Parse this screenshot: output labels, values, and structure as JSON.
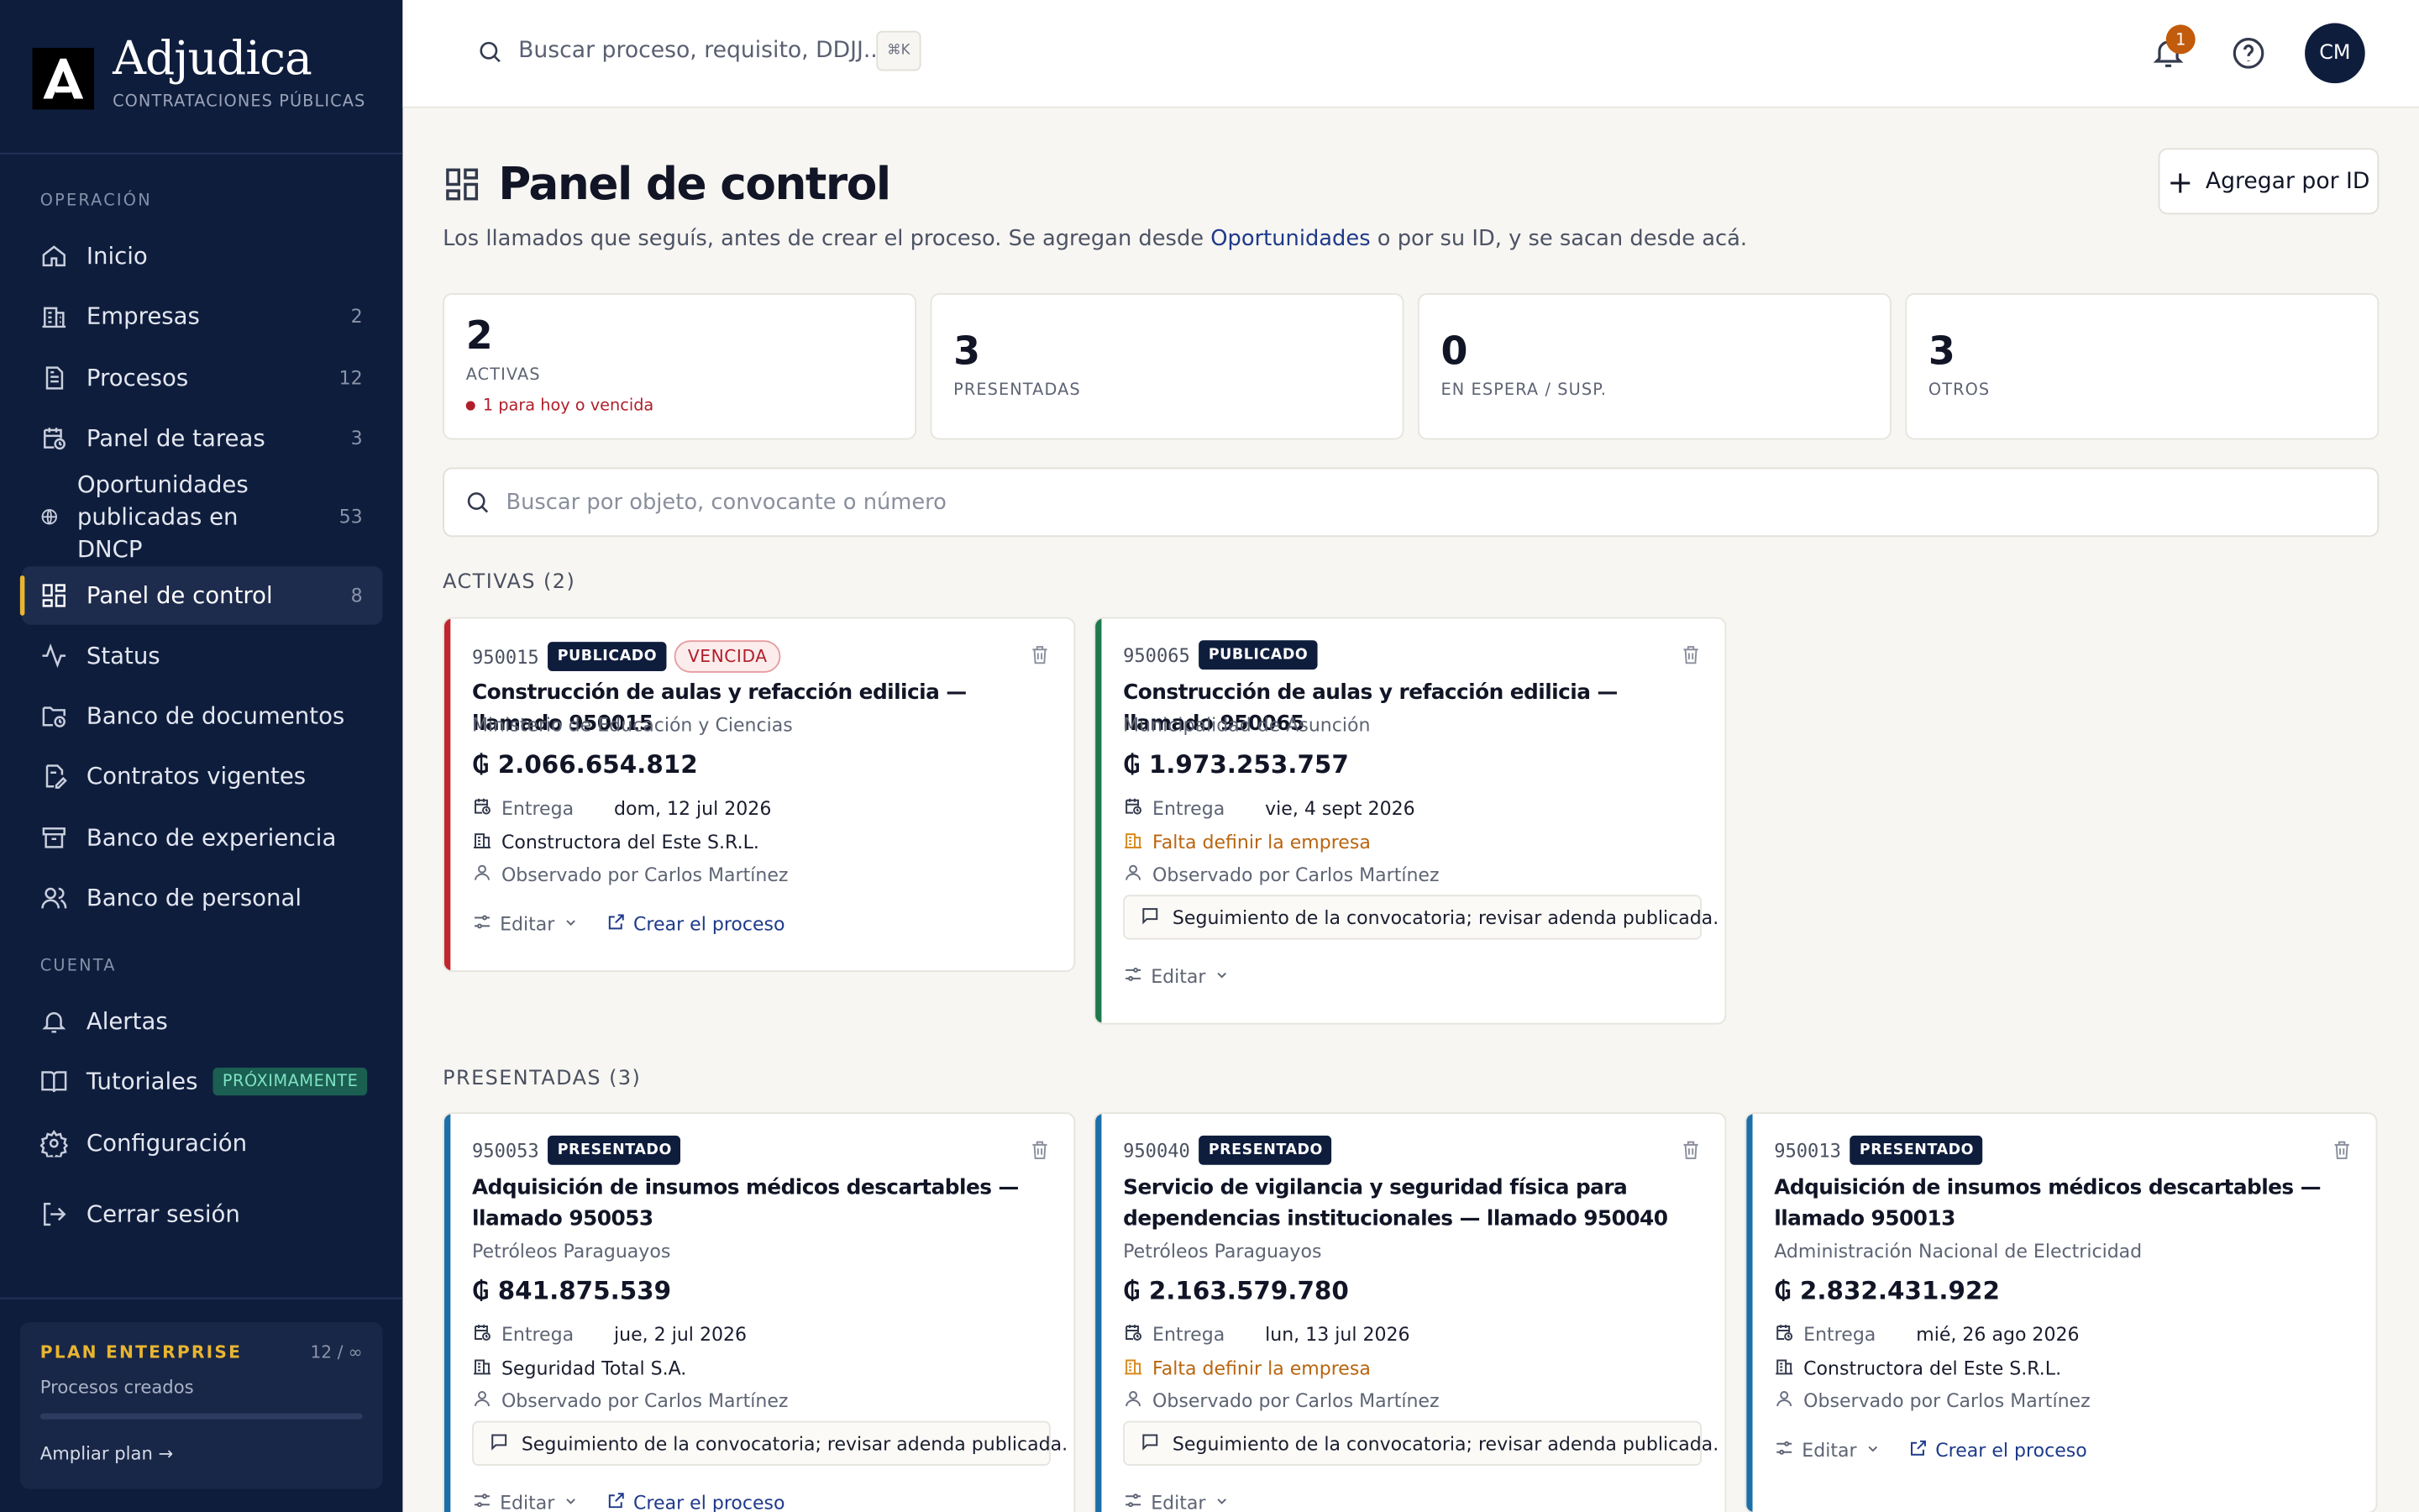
{
  "brand": {
    "name": "Adjudica",
    "subtitle": "CONTRATACIONES PÚBLICAS"
  },
  "sidebar": {
    "section_operacion": "OPERACIÓN",
    "section_cuenta": "CUENTA",
    "items": [
      {
        "label": "Inicio",
        "count": ""
      },
      {
        "label": "Empresas",
        "count": "2"
      },
      {
        "label": "Procesos",
        "count": "12"
      },
      {
        "label": "Panel de tareas",
        "count": "3"
      },
      {
        "label": "Oportunidades publicadas en DNCP",
        "count": "53"
      },
      {
        "label": "Panel de control",
        "count": "8"
      },
      {
        "label": "Status",
        "count": ""
      },
      {
        "label": "Banco de documentos",
        "count": ""
      },
      {
        "label": "Contratos vigentes",
        "count": ""
      },
      {
        "label": "Banco de experiencia",
        "count": ""
      },
      {
        "label": "Banco de personal",
        "count": ""
      }
    ],
    "account_items": [
      {
        "label": "Alertas"
      },
      {
        "label": "Tutoriales",
        "badge": "PRÓXIMAMENTE"
      },
      {
        "label": "Configuración"
      },
      {
        "label": "Cerrar sesión"
      }
    ],
    "plan": {
      "title": "PLAN ENTERPRISE",
      "count": "12 / ∞",
      "subtitle": "Procesos creados",
      "progress": 0.0,
      "link": "Ampliar plan →"
    }
  },
  "header": {
    "search_placeholder": "Buscar proceso, requisito, DDJJ...",
    "shortcut": "⌘K",
    "notifications": "1",
    "avatar": "CM"
  },
  "page": {
    "title": "Panel de control",
    "add_button": "Agregar por ID",
    "subtitle_pre": "Los llamados que seguís, antes de crear el proceso. Se agregan desde ",
    "subtitle_link": "Oportunidades",
    "subtitle_post": " o por su ID, y se sacan desde acá.",
    "search_placeholder": "Buscar por objeto, convocante o número"
  },
  "stats": [
    {
      "value": "2",
      "label": "ACTIVAS",
      "alert": "1 para hoy o vencida"
    },
    {
      "value": "3",
      "label": "PRESENTADAS"
    },
    {
      "value": "0",
      "label": "EN ESPERA / SUSP."
    },
    {
      "value": "3",
      "label": "OTROS"
    }
  ],
  "groups": {
    "activas": "ACTIVAS (2)",
    "presentadas": "PRESENTADAS (3)"
  },
  "labels": {
    "entrega": "Entrega",
    "editar": "Editar",
    "crear": "Crear el proceso"
  },
  "cards": [
    {
      "id": "950015",
      "status": "PUBLICADO",
      "flag": "VENCIDA",
      "title": "Construcción de aulas y refacción edilicia — llamado 950015",
      "org": "Ministerio de Educación y Ciencias",
      "amount": "₲ 2.066.654.812",
      "date": "dom, 12 jul 2026",
      "company": "Constructora del Este S.R.L.",
      "observer": "Observado por Carlos Martínez",
      "note": "",
      "accent": "#c0262d"
    },
    {
      "id": "950065",
      "status": "PUBLICADO",
      "flag": "",
      "title": "Construcción de aulas y refacción edilicia — llamado 950065",
      "org": "Municipalidad de Asunción",
      "amount": "₲ 1.973.253.757",
      "date": "vie, 4 sept 2026",
      "company": "Falta definir la empresa",
      "observer": "Observado por Carlos Martínez",
      "note": "Seguimiento de la convocatoria; revisar adenda publicada.",
      "accent": "#1d7a4c"
    },
    {
      "id": "950053",
      "status": "PRESENTADO",
      "flag": "",
      "title": "Adquisición de insumos médicos descartables — llamado 950053",
      "org": "Petróleos Paraguayos",
      "amount": "₲ 841.875.539",
      "date": "jue, 2 jul 2026",
      "company": "Seguridad Total S.A.",
      "observer": "Observado por Carlos Martínez",
      "note": "Seguimiento de la convocatoria; revisar adenda publicada.",
      "accent": "#1c6fa8"
    },
    {
      "id": "950040",
      "status": "PRESENTADO",
      "flag": "",
      "title": "Servicio de vigilancia y seguridad física para dependencias institucionales — llamado 950040",
      "org": "Petróleos Paraguayos",
      "amount": "₲ 2.163.579.780",
      "date": "lun, 13 jul 2026",
      "company": "Falta definir la empresa",
      "observer": "Observado por Carlos Martínez",
      "note": "Seguimiento de la convocatoria; revisar adenda publicada.",
      "accent": "#1c6fa8"
    },
    {
      "id": "950013",
      "status": "PRESENTADO",
      "flag": "",
      "title": "Adquisición de insumos médicos descartables — llamado 950013",
      "org": "Administración Nacional de Electricidad",
      "amount": "₲ 2.832.431.922",
      "date": "mié, 26 ago 2026",
      "company": "Constructora del Este S.R.L.",
      "observer": "Observado por Carlos Martínez",
      "note": "",
      "accent": "#1c6fa8"
    }
  ],
  "icons": [
    "search-icon",
    "bell-icon",
    "help-icon",
    "dashboard-icon",
    "plus-icon",
    "trash-icon",
    "calendar-icon",
    "building-icon",
    "user-icon",
    "message-icon",
    "sliders-icon",
    "chevron-down-icon",
    "external-link-icon"
  ]
}
